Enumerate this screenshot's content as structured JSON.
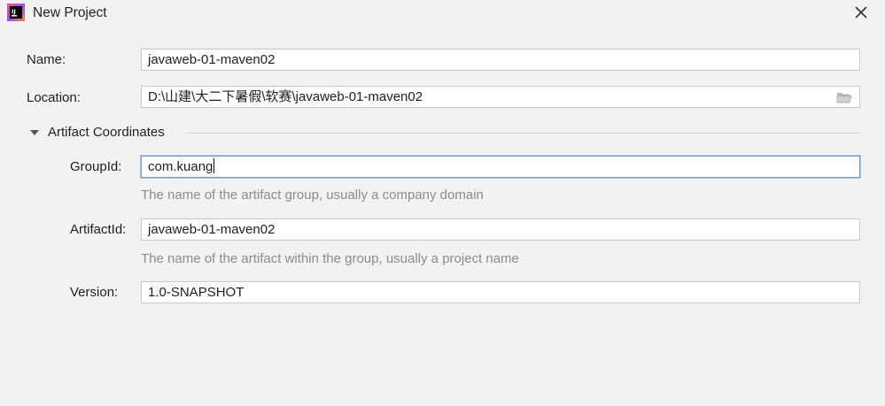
{
  "window": {
    "title": "New Project",
    "icon": "intellij-idea-icon",
    "close_icon": "close-icon"
  },
  "form": {
    "name": {
      "label": "Name:",
      "value": "javaweb-01-maven02"
    },
    "location": {
      "label": "Location:",
      "value": "D:\\山建\\大二下暑假\\软赛\\javaweb-01-maven02",
      "browse_icon": "folder-icon"
    },
    "artifact_section": {
      "title": "Artifact Coordinates",
      "expanded": true,
      "group_id": {
        "label": "GroupId:",
        "value": "com.kuang",
        "hint": "The name of the artifact group, usually a company domain"
      },
      "artifact_id": {
        "label": "ArtifactId:",
        "value": "javaweb-01-maven02",
        "hint": "The name of the artifact within the group, usually a project name"
      },
      "version": {
        "label": "Version:",
        "value": "1.0-SNAPSHOT"
      }
    }
  },
  "colors": {
    "background": "#f2f2f2",
    "field_border": "#c9c9c9",
    "focus_border": "#6b9bd6",
    "hint_text": "#8c8c8c"
  }
}
